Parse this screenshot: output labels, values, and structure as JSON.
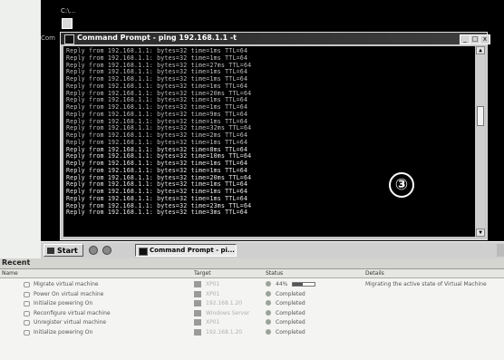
{
  "desktop": {
    "icon_label": "C:\\...",
    "cut_label": "Com"
  },
  "cmd": {
    "title": "Command Prompt - ping 192.168.1.1 -t",
    "minimize": "_",
    "maximize": "□",
    "close": "x",
    "lines": [
      "Reply from 192.168.1.1: bytes=32 time=1ms TTL=64",
      "Reply from 192.168.1.1: bytes=32 time=1ms TTL=64",
      "Reply from 192.168.1.1: bytes=32 time=27ms TTL=64",
      "Reply from 192.168.1.1: bytes=32 time=1ms TTL=64",
      "Reply from 192.168.1.1: bytes=32 time=1ms TTL=64",
      "Reply from 192.168.1.1: bytes=32 time=1ms TTL=64",
      "Reply from 192.168.1.1: bytes=32 time=20ms TTL=64",
      "Reply from 192.168.1.1: bytes=32 time=1ms TTL=64",
      "Reply from 192.168.1.1: bytes=32 time=1ms TTL=64",
      "Reply from 192.168.1.1: bytes=32 time=9ms TTL=64",
      "Reply from 192.168.1.1: bytes=32 time=1ms TTL=64",
      "Reply from 192.168.1.1: bytes=32 time=32ms TTL=64",
      "Reply from 192.168.1.1: bytes=32 time=2ms TTL=64",
      "Reply from 192.168.1.1: bytes=32 time=1ms TTL=64",
      "Reply from 192.168.1.1: bytes=32 time=8ms TTL=64",
      "Reply from 192.168.1.1: bytes=32 time=10ms TTL=64",
      "Reply from 192.168.1.1: bytes=32 time=1ms TTL=64",
      "Reply from 192.168.1.1: bytes=32 time=1ms TTL=64",
      "Reply from 192.168.1.1: bytes=32 time=20ms TTL=64",
      "Reply from 192.168.1.1: bytes=32 time=1ms TTL=64",
      "Reply from 192.168.1.1: bytes=32 time=1ms TTL=64",
      "Reply from 192.168.1.1: bytes=32 time=1ms TTL=64",
      "Reply from 192.168.1.1: bytes=32 time=23ms TTL=64",
      "Reply from 192.168.1.1: bytes=32 time=3ms TTL=64"
    ]
  },
  "marker": "③",
  "taskbar": {
    "start": "Start",
    "task": "Command Prompt - pi..."
  },
  "recent": {
    "header": "Recent",
    "columns": {
      "name": "Name",
      "target": "Target",
      "status": "Status",
      "details": "Details"
    },
    "rows": [
      {
        "name": "Migrate virtual machine",
        "target": "XP01",
        "status": "44%",
        "progress": 0.44,
        "details": "Migrating the active state of Virtual Machine"
      },
      {
        "name": "Power On virtual machine",
        "target": "XP01",
        "status": "Completed"
      },
      {
        "name": "Initialize powering On",
        "target": "192.168.1.20",
        "status": "Completed"
      },
      {
        "name": "Reconfigure virtual machine",
        "target": "Windows Server",
        "status": "Completed"
      },
      {
        "name": "Unregister virtual machine",
        "target": "XP01",
        "status": "Completed"
      },
      {
        "name": "Initialize powering On",
        "target": "192.168.1.20",
        "status": "Completed"
      }
    ]
  }
}
